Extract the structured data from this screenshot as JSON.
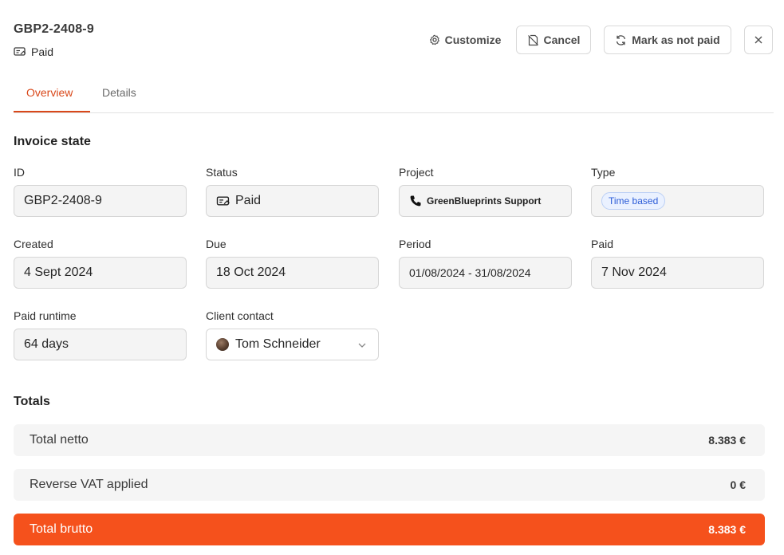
{
  "header": {
    "invoice_id": "GBP2-2408-9",
    "status": "Paid",
    "buttons": {
      "customize": "Customize",
      "cancel": "Cancel",
      "mark_not_paid": "Mark as not paid"
    }
  },
  "tabs": [
    {
      "label": "Overview",
      "active": true
    },
    {
      "label": "Details",
      "active": false
    }
  ],
  "invoice_state": {
    "title": "Invoice state",
    "fields": {
      "id": {
        "label": "ID",
        "value": "GBP2-2408-9"
      },
      "status": {
        "label": "Status",
        "value": "Paid"
      },
      "project": {
        "label": "Project",
        "value": "GreenBlueprints Support"
      },
      "type": {
        "label": "Type",
        "value": "Time based"
      },
      "created": {
        "label": "Created",
        "value": "4 Sept 2024"
      },
      "due": {
        "label": "Due",
        "value": "18 Oct 2024"
      },
      "period": {
        "label": "Period",
        "value": "01/08/2024 - 31/08/2024"
      },
      "paid": {
        "label": "Paid",
        "value": "7 Nov 2024"
      },
      "paid_runtime": {
        "label": "Paid runtime",
        "value": "64 days"
      },
      "client_contact": {
        "label": "Client contact",
        "value": "Tom Schneider"
      }
    }
  },
  "totals": {
    "title": "Totals",
    "rows": [
      {
        "label": "Total netto",
        "value": "8.383 €"
      },
      {
        "label": "Reverse VAT applied",
        "value": "0 €"
      },
      {
        "label": "Total brutto",
        "value": "8.383 €"
      }
    ]
  },
  "colors": {
    "accent": "#f5511c",
    "tab_active": "#d9481a",
    "badge_blue": "#2a5bd7"
  },
  "icons": {
    "status": "invoice-paid-icon",
    "customize": "gear-icon",
    "cancel": "cancel-document-icon",
    "mark_not_paid": "refresh-icon",
    "close": "close-icon",
    "project": "phone-icon",
    "client_contact": "avatar",
    "dropdown": "chevron-down-icon"
  }
}
